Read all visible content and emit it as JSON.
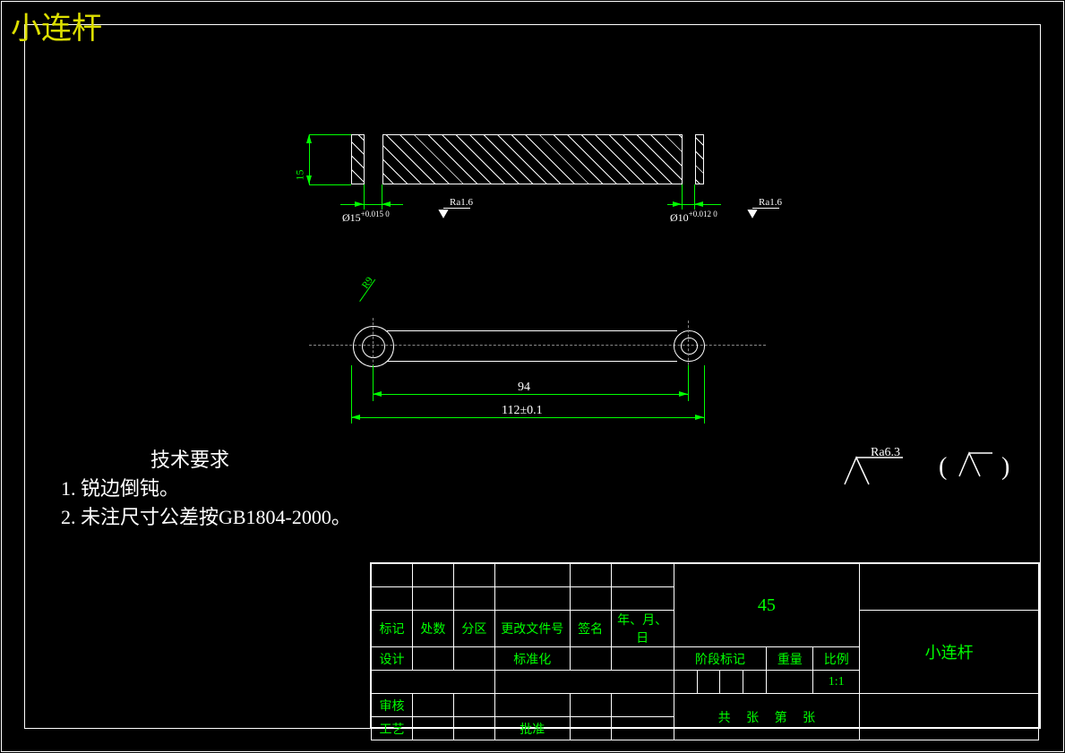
{
  "title": "小连杆",
  "section_view": {
    "height_dim": "15",
    "left_dia": "Ø15",
    "left_tol": "+0.015 0",
    "left_ra": "Ra1.6",
    "right_dia": "Ø10",
    "right_tol": "+0.012 0",
    "right_ra": "Ra1.6"
  },
  "plan_view": {
    "radius_label": "R9",
    "center_dist": "94",
    "overall_len": "112±0.1"
  },
  "surface_finish": {
    "general_ra": "Ra6.3",
    "paren": "( √ )"
  },
  "requirements": {
    "header": "技术要求",
    "item1": "1. 锐边倒钝。",
    "item2": "2. 未注尺寸公差按GB1804-2000。"
  },
  "title_block": {
    "material": "45",
    "part_name": "小连杆",
    "row_headers": [
      "标记",
      "处数",
      "分区",
      "更改文件号",
      "签名",
      "年、月、日"
    ],
    "design": "设计",
    "standard": "标准化",
    "review": "审核",
    "process": "工艺",
    "approve": "批准",
    "stage_mark": "阶段标记",
    "weight": "重量",
    "scale_label": "比例",
    "scale_value": "1:1",
    "sheet_gong": "共",
    "sheet_zhang1": "张",
    "sheet_di": "第",
    "sheet_zhang2": "张"
  }
}
